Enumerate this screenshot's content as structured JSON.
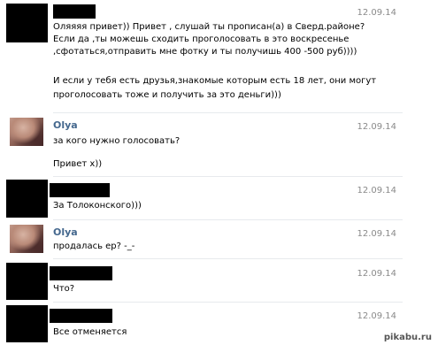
{
  "messages": [
    {
      "date": "12.09.14",
      "lines": [
        "Оляяяя привет)) Привет , слушай ты прописан(а) в Сверд.районе?",
        "Если да ,ты можешь сходить проголосовать в это воскресенье",
        ",сфотаться,отправить мне фотку и ты получишь 400 -500 руб))))",
        "",
        "И если у тебя есть друзья,знакомые которым есть 18 лет, они могут",
        "проголосовать тоже и получить за это деньги)))"
      ]
    },
    {
      "sender": "Olya",
      "date": "12.09.14",
      "lines": [
        "за кого нужно голосовать?",
        "",
        "Привет х))"
      ]
    },
    {
      "date": "12.09.14",
      "lines": [
        "За Толоконского)))"
      ]
    },
    {
      "sender": "Olya",
      "date": "12.09.14",
      "lines": [
        "продалась ер? -_-"
      ]
    },
    {
      "date": "12.09.14",
      "lines": [
        "Что?"
      ]
    },
    {
      "date": "12.09.14",
      "lines": [
        "Все отменяется"
      ]
    }
  ],
  "watermark": "pikabu.ru"
}
